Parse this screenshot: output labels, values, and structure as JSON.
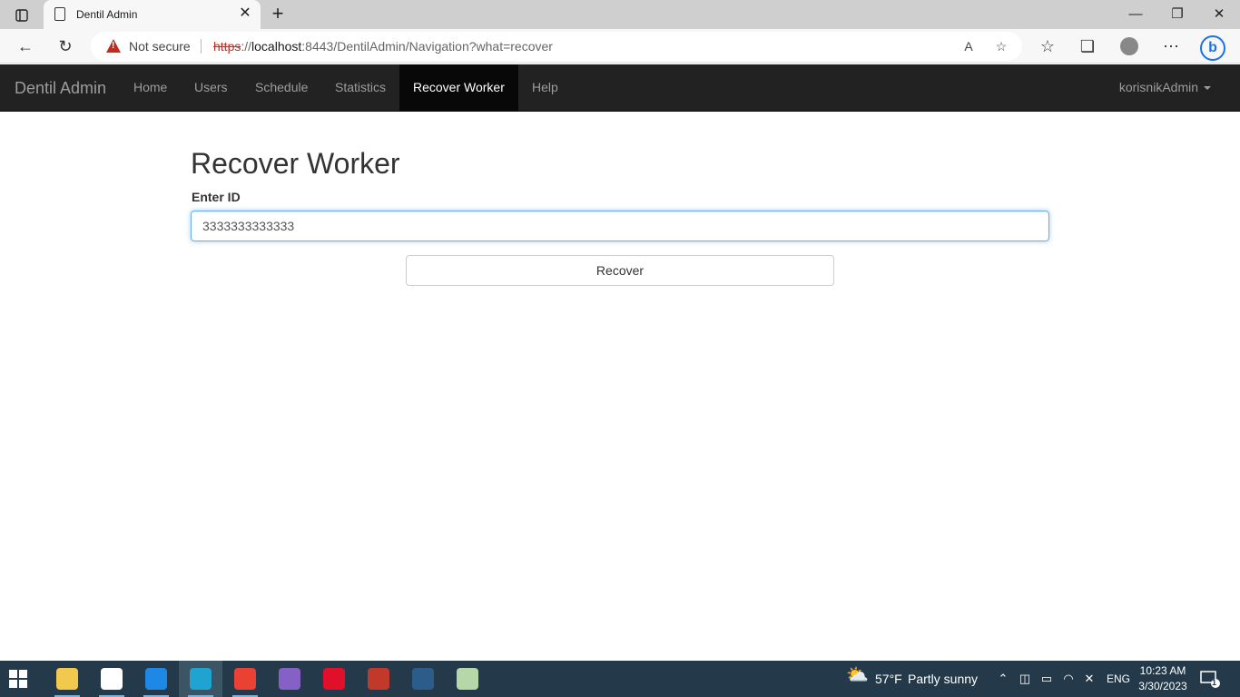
{
  "browser": {
    "tab_title": "Dentil Admin",
    "security_label": "Not secure",
    "url": {
      "scheme": "https",
      "sep": "://",
      "host": "localhost",
      "rest": ":8443/DentilAdmin/Navigation?what=recover"
    }
  },
  "navbar": {
    "brand": "Dentil Admin",
    "items": [
      {
        "label": "Home"
      },
      {
        "label": "Users"
      },
      {
        "label": "Schedule"
      },
      {
        "label": "Statistics"
      },
      {
        "label": "Recover Worker",
        "active": true
      },
      {
        "label": "Help"
      }
    ],
    "user": "korisnikAdmin"
  },
  "main": {
    "title": "Recover Worker",
    "id_label": "Enter ID",
    "id_value": "3333333333333",
    "recover_label": "Recover"
  },
  "taskbar": {
    "weather": {
      "temp": "57°F",
      "condition": "Partly sunny"
    },
    "language": "ENG",
    "time": "10:23 AM",
    "date": "3/30/2023",
    "notification_count": "1",
    "apps": [
      {
        "name": "file-explorer-icon",
        "color": "#f2c94c"
      },
      {
        "name": "store-icon",
        "color": "#ffffff"
      },
      {
        "name": "mail-icon",
        "color": "#1e88e5"
      },
      {
        "name": "edge-icon",
        "color": "#1fa3d1"
      },
      {
        "name": "chrome-icon",
        "color": "#e94235"
      },
      {
        "name": "visual-studio-icon",
        "color": "#8661c5"
      },
      {
        "name": "opera-icon",
        "color": "#e0102a"
      },
      {
        "name": "game-app-icon",
        "color": "#c0392b"
      },
      {
        "name": "sql-workbench-icon",
        "color": "#2b5c8a"
      },
      {
        "name": "paint-icon",
        "color": "#b6d7a8"
      }
    ]
  },
  "colors": {
    "navbar_bg": "#222222",
    "taskbar_bg": "#243a4a",
    "input_focus": "#66afe9"
  }
}
